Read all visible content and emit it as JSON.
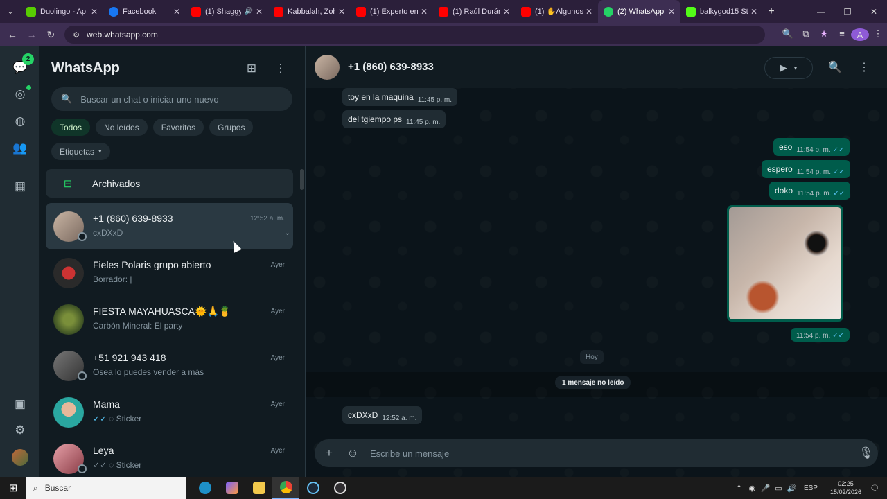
{
  "browser": {
    "tabs": [
      {
        "title": "Duolingo - Ap",
        "color": "#58cc02",
        "icon": "duolingo-icon"
      },
      {
        "title": "Facebook",
        "color": "#1877f2",
        "icon": "facebook-icon"
      },
      {
        "title": "(1) Shaggy",
        "color": "#ff0000",
        "icon": "youtube-icon",
        "audio": true
      },
      {
        "title": "Kabbalah, Zoh",
        "color": "#ff0000",
        "icon": "youtube-icon"
      },
      {
        "title": "(1) Experto en",
        "color": "#ff0000",
        "icon": "youtube-icon"
      },
      {
        "title": "(1) Raúl Durán",
        "color": "#ff0000",
        "icon": "youtube-icon"
      },
      {
        "title": "(1) ✋Algunos",
        "color": "#ff0000",
        "icon": "youtube-icon"
      },
      {
        "title": "(2) WhatsApp",
        "color": "#25d366",
        "icon": "whatsapp-icon",
        "active": true
      },
      {
        "title": "balkygod15 St",
        "color": "#53fc18",
        "icon": "kick-icon"
      }
    ],
    "url": "web.whatsapp.com",
    "profile_initial": "A"
  },
  "rail": {
    "unread_badge": "2"
  },
  "sidebar": {
    "title": "WhatsApp",
    "search_placeholder": "Buscar un chat o iniciar uno nuevo",
    "filters": [
      "Todos",
      "No leídos",
      "Favoritos",
      "Grupos"
    ],
    "labels_filter": "Etiquetas",
    "archived": "Archivados",
    "chats": [
      {
        "name": "+1 (860) 639-8933",
        "time": "12:52 a. m.",
        "preview": "cxDXxD",
        "selected": true,
        "avatar": "#9c8275"
      },
      {
        "name": "Fieles Polaris grupo abierto",
        "time": "Ayer",
        "preview": "Borrador: |",
        "avatar": "#3a3a3a"
      },
      {
        "name": "FIESTA MAYAHUASCA🌞🙏🍍",
        "time": "Ayer",
        "preview": "Carbón Mineral: El party",
        "avatar": "#4e6b2e"
      },
      {
        "name": "+51 921 943 418",
        "time": "Ayer",
        "preview": "Osea lo puedes vender a más",
        "avatar": "#5a5f66"
      },
      {
        "name": "Mama",
        "time": "Ayer",
        "preview": "Sticker",
        "ticks": "✓✓",
        "avatar": "#2aa7a0"
      },
      {
        "name": "Leya",
        "time": "Ayer",
        "preview": "Sticker",
        "ticks": "✓✓",
        "avatar": "#c56b73"
      }
    ]
  },
  "conversation": {
    "contact": "+1 (860) 639-8933",
    "messages": [
      {
        "text": "toy en la maquina",
        "time": "11:45 p. m.",
        "dir": "in"
      },
      {
        "text": "del tgiempo ps",
        "time": "11:45 p. m.",
        "dir": "in"
      },
      {
        "text": "eso",
        "time": "11:54 p. m.",
        "dir": "out"
      },
      {
        "text": "espero",
        "time": "11:54 p. m.",
        "dir": "out"
      },
      {
        "text": "doko",
        "time": "11:54 p. m.",
        "dir": "out"
      },
      {
        "text": "",
        "time": "11:54 p. m.",
        "dir": "out",
        "type": "image"
      },
      {
        "text": "cxDXxD",
        "time": "12:52 a. m.",
        "dir": "in"
      }
    ],
    "day_separator": "Hoy",
    "unread_notice": "1 mensaje no leído",
    "composer_placeholder": "Escribe un mensaje"
  },
  "taskbar": {
    "search": "Buscar",
    "lang": "ESP",
    "time": "02:25",
    "date": "15/02/2026"
  }
}
